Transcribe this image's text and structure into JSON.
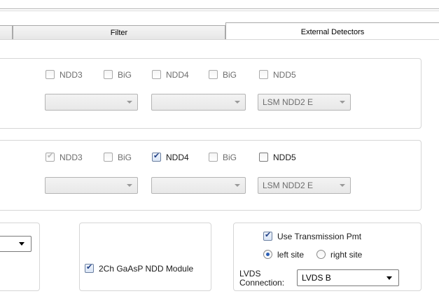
{
  "tabs": [
    {
      "label": "Filter"
    },
    {
      "label": "External Detectors"
    }
  ],
  "group1": {
    "checkboxes": [
      {
        "label": "NDD3",
        "checked": false
      },
      {
        "label": "BiG",
        "checked": false
      },
      {
        "label": "NDD4",
        "checked": false
      },
      {
        "label": "BiG",
        "checked": false
      },
      {
        "label": "NDD5",
        "checked": false
      }
    ],
    "combos": [
      {
        "value": ""
      },
      {
        "value": ""
      },
      {
        "value": "LSM NDD2 E"
      }
    ]
  },
  "group2": {
    "checkboxes": [
      {
        "label": "NDD3",
        "checked": true
      },
      {
        "label": "BiG",
        "checked": false
      },
      {
        "label": "NDD4",
        "checked": true
      },
      {
        "label": "BiG",
        "checked": false
      },
      {
        "label": "NDD5",
        "checked": false
      }
    ],
    "combos": [
      {
        "value": ""
      },
      {
        "value": ""
      },
      {
        "value": "LSM NDD2 E"
      }
    ]
  },
  "bottom": {
    "left_combo": {
      "value": ""
    },
    "module": {
      "label": "2Ch GaAsP NDD Module",
      "checked": true
    },
    "transmission": {
      "use_label": "Use Transmission Pmt",
      "use_checked": true,
      "radio_left": "left site",
      "radio_right": "right site",
      "selected": "left site",
      "lvds_label_line1": "LVDS",
      "lvds_label_line2": "Connection:",
      "lvds_value": "LVDS B"
    }
  }
}
